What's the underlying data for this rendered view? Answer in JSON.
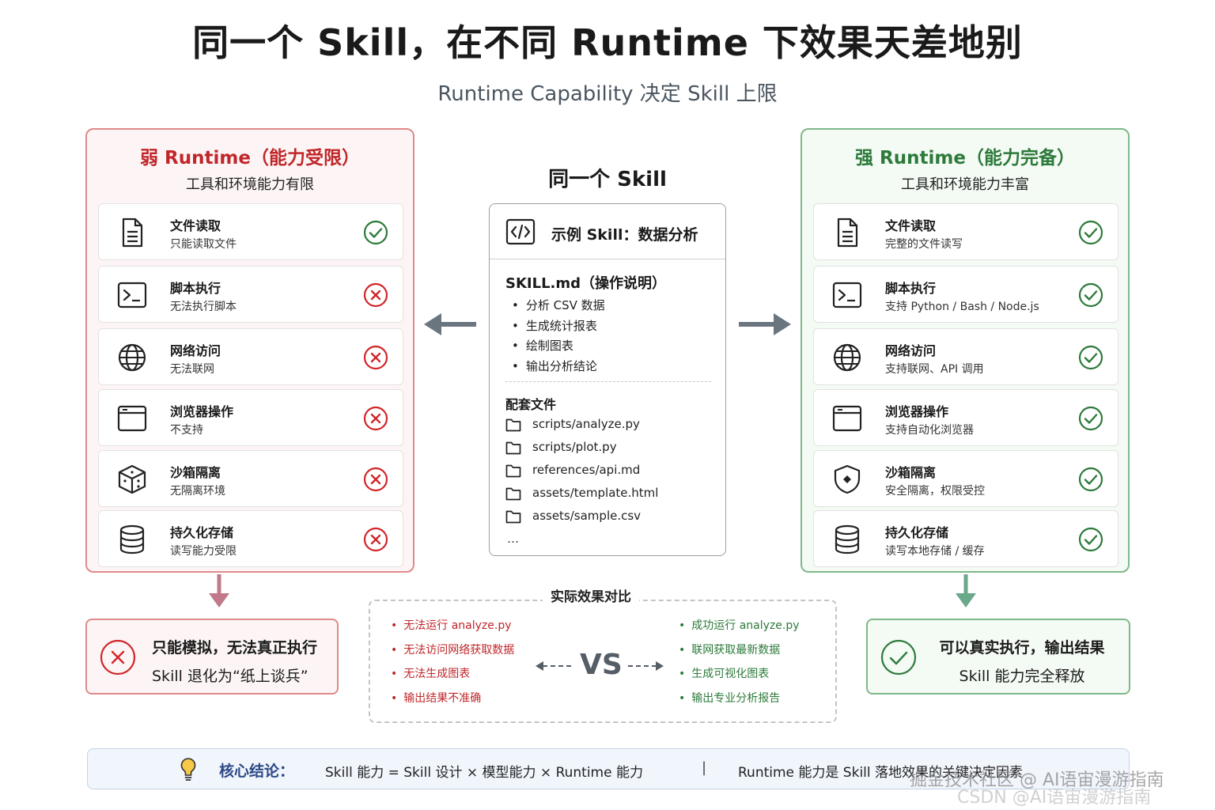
{
  "title": "同一个 Skill，在不同 Runtime 下效果天差地别",
  "subtitle": "Runtime Capability 决定 Skill 上限",
  "colors": {
    "weak": "#c0262a",
    "strong": "#2c7a3a",
    "neutral_arrow": "#6b7580"
  },
  "weak_panel": {
    "title": "弱 Runtime（能力受限）",
    "subtitle": "工具和环境能力有限",
    "items": [
      {
        "icon": "file-icon",
        "name": "文件读取",
        "desc": "只能读取文件",
        "status": "check"
      },
      {
        "icon": "terminal-icon",
        "name": "脚本执行",
        "desc": "无法执行脚本",
        "status": "cross"
      },
      {
        "icon": "globe-icon",
        "name": "网络访问",
        "desc": "无法联网",
        "status": "cross"
      },
      {
        "icon": "browser-icon",
        "name": "浏览器操作",
        "desc": "不支持",
        "status": "cross"
      },
      {
        "icon": "box-icon",
        "name": "沙箱隔离",
        "desc": "无隔离环境",
        "status": "cross"
      },
      {
        "icon": "database-icon",
        "name": "持久化存储",
        "desc": "读写能力受限",
        "status": "cross"
      }
    ]
  },
  "strong_panel": {
    "title": "强 Runtime（能力完备）",
    "subtitle": "工具和环境能力丰富",
    "items": [
      {
        "icon": "file-icon",
        "name": "文件读取",
        "desc": "完整的文件读写",
        "status": "check"
      },
      {
        "icon": "terminal-icon",
        "name": "脚本执行",
        "desc": "支持 Python / Bash / Node.js",
        "status": "check"
      },
      {
        "icon": "globe-icon",
        "name": "网络访问",
        "desc": "支持联网、API 调用",
        "status": "check"
      },
      {
        "icon": "browser-icon",
        "name": "浏览器操作",
        "desc": "支持自动化浏览器",
        "status": "check"
      },
      {
        "icon": "shield-icon",
        "name": "沙箱隔离",
        "desc": "安全隔离，权限受控",
        "status": "check"
      },
      {
        "icon": "database-icon",
        "name": "持久化存储",
        "desc": "读写本地存储 / 缓存",
        "status": "check"
      }
    ]
  },
  "skill": {
    "heading": "同一个 Skill",
    "card_title": "示例 Skill：数据分析",
    "md_title": "SKILL.md（操作说明）",
    "steps": [
      "分析 CSV 数据",
      "生成统计报表",
      "绘制图表",
      "输出分析结论"
    ],
    "files_title": "配套文件",
    "files": [
      "scripts/analyze.py",
      "scripts/plot.py",
      "references/api.md",
      "assets/template.html",
      "assets/sample.csv"
    ],
    "ellipsis": "…"
  },
  "results": {
    "weak": {
      "line1": "只能模拟，无法真正执行",
      "line2": "Skill 退化为“纸上谈兵”"
    },
    "strong": {
      "line1": "可以真实执行，输出结果",
      "line2": "Skill 能力完全释放"
    }
  },
  "comparison": {
    "title": "实际效果对比",
    "vs": "VS",
    "bad": [
      "无法运行 analyze.py",
      "无法访问网络获取数据",
      "无法生成图表",
      "输出结果不准确"
    ],
    "good": [
      "成功运行 analyze.py",
      "联网获取最新数据",
      "生成可视化图表",
      "输出专业分析报告"
    ]
  },
  "conclusion": {
    "label": "核心结论：",
    "formula": "Skill 能力 = Skill 设计 × 模型能力 × Runtime 能力",
    "divider": "|",
    "statement": "Runtime 能力是 Skill 落地效果的关键决定因素"
  },
  "watermark": {
    "line1": "掘金技术社区 @ AI语宙漫游指南",
    "line2": "CSDN @AI语宙漫游指南"
  }
}
